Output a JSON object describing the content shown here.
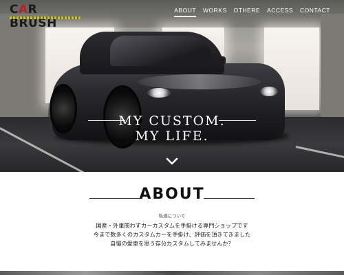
{
  "header": {
    "logo": {
      "part1": "C",
      "accent": "A",
      "part2": "R BRUSH"
    },
    "nav": [
      {
        "label": "ABOUT",
        "active": true
      },
      {
        "label": "WORKS",
        "active": false
      },
      {
        "label": "OTHERE",
        "active": false
      },
      {
        "label": "ACCESS",
        "active": false
      },
      {
        "label": "CONTACT",
        "active": false
      }
    ]
  },
  "hero": {
    "tagline_line1": "MY CUSTOM.",
    "tagline_line2": "MY LIFE.",
    "scroll_icon": "chevron-down-icon"
  },
  "about": {
    "title": "ABOUT",
    "subtitle": "私達について",
    "body": [
      "国産・外車問わずカーカスタムを手掛ける専門ショップです",
      "今まで数多くのカスタムカーを手掛け、評価を頂きてきました",
      "自慢の愛車を思う存分カスタムしてみませんか？"
    ]
  },
  "colors": {
    "logo_accent": "#b4242a",
    "nav_text": "#ffffff",
    "heading": "#111111"
  }
}
